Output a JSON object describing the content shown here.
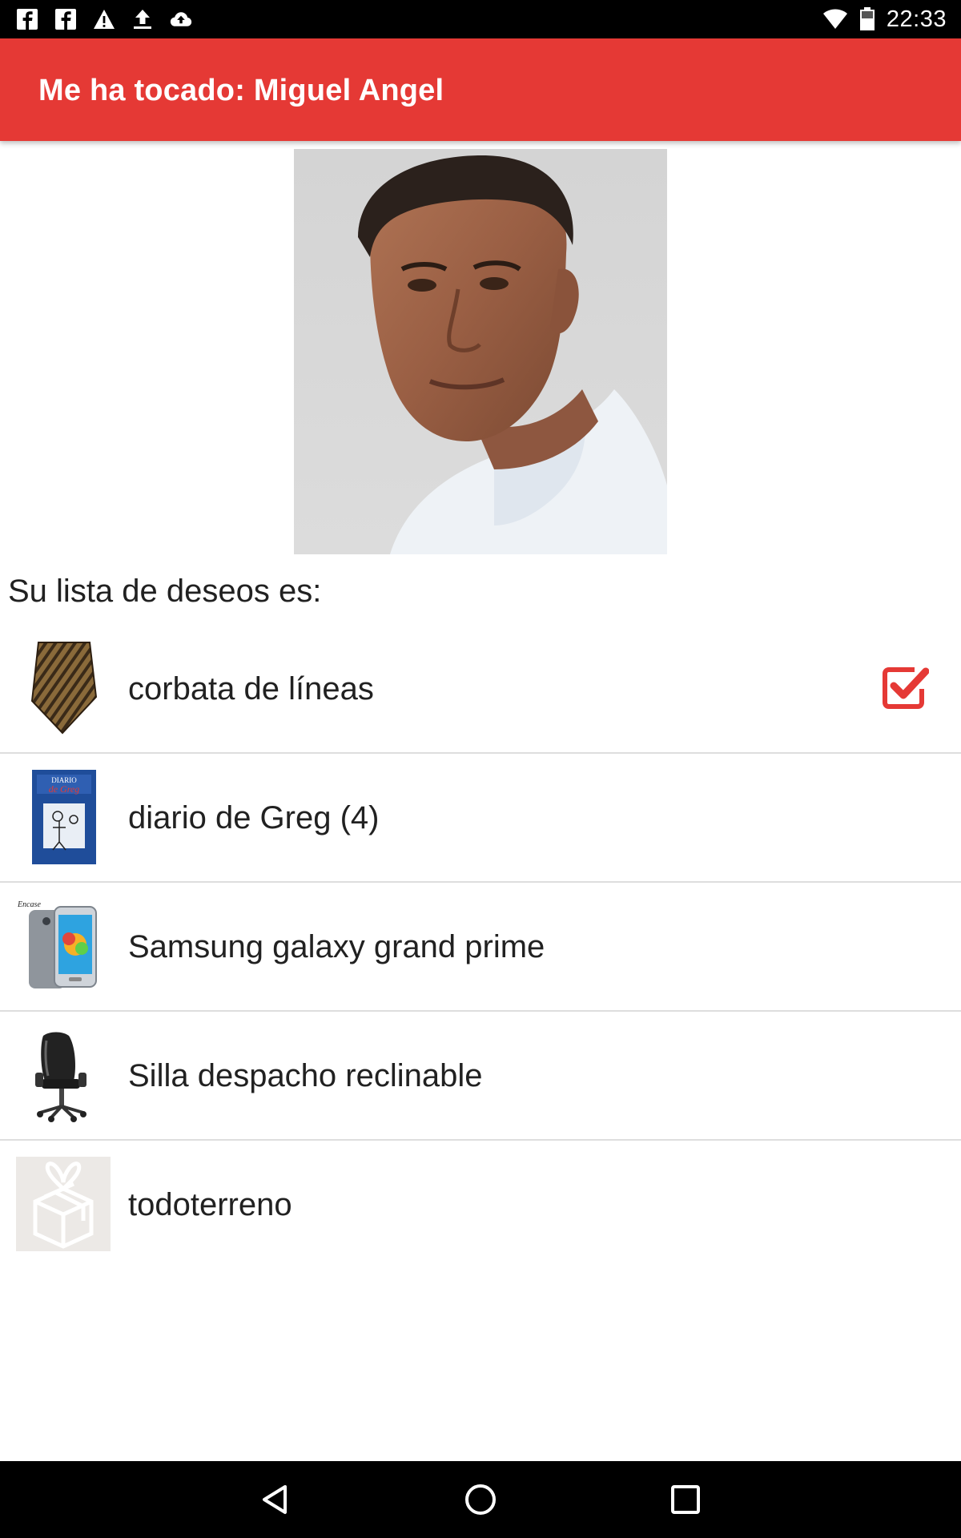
{
  "status_bar": {
    "time": "22:33",
    "icons": [
      "facebook-icon",
      "facebook-icon",
      "warning-icon",
      "upload-icon",
      "cloud-upload-icon",
      "wifi-icon",
      "battery-icon"
    ]
  },
  "app_bar": {
    "title": "Me ha tocado: Miguel Angel"
  },
  "profile": {
    "photo_icon": "person-photo"
  },
  "wishlist": {
    "heading": "Su lista de deseos es:",
    "items": [
      {
        "label": "corbata de líneas",
        "thumb": "tie-icon",
        "checked": true
      },
      {
        "label": "diario de Greg  (4)",
        "thumb": "book-cover-icon",
        "checked": false
      },
      {
        "label": "Samsung galaxy grand prime",
        "thumb": "smartphone-icon",
        "checked": false
      },
      {
        "label": "Silla despacho reclinable",
        "thumb": "office-chair-icon",
        "checked": false
      },
      {
        "label": "todoterreno",
        "thumb": "gift-box-icon",
        "checked": false
      }
    ]
  },
  "colors": {
    "app_bar": "#e53935",
    "check": "#e53935",
    "divider": "#dedede"
  },
  "nav_bar": {
    "buttons": [
      "back-icon",
      "home-icon",
      "recents-icon"
    ]
  }
}
